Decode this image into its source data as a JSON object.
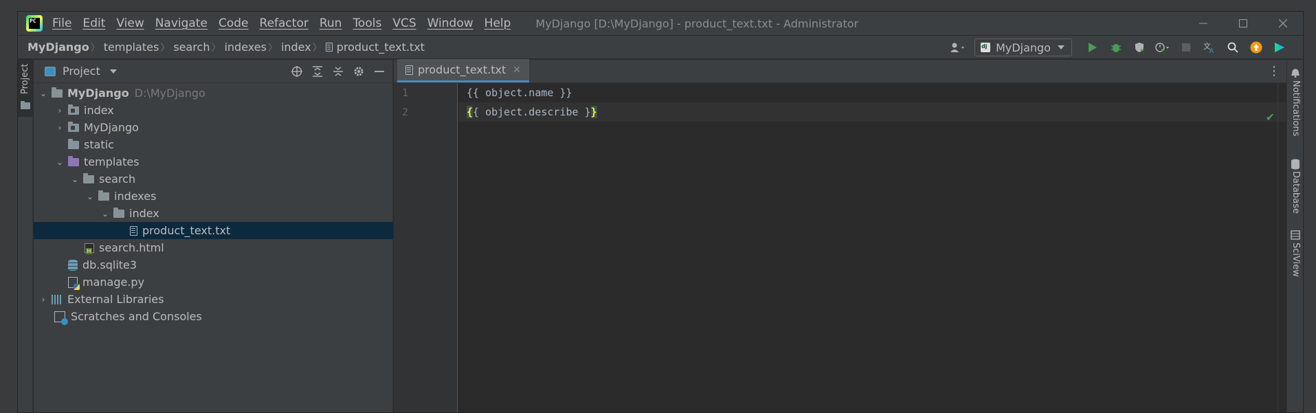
{
  "titlebar": {
    "menu": [
      "File",
      "Edit",
      "View",
      "Navigate",
      "Code",
      "Refactor",
      "Run",
      "Tools",
      "VCS",
      "Window",
      "Help"
    ],
    "window_title": "MyDjango [D:\\MyDjango] - product_text.txt - Administrator"
  },
  "breadcrumbs": [
    "MyDjango",
    "templates",
    "search",
    "indexes",
    "index",
    "product_text.txt"
  ],
  "run_config": {
    "label": "MyDjango"
  },
  "left_strip": {
    "tab_label": "Project"
  },
  "project_panel": {
    "title": "Project",
    "tree": [
      {
        "label": "MyDjango",
        "hint": "D:\\MyDjango"
      },
      {
        "label": "index"
      },
      {
        "label": "MyDjango"
      },
      {
        "label": "static"
      },
      {
        "label": "templates"
      },
      {
        "label": "search"
      },
      {
        "label": "indexes"
      },
      {
        "label": "index"
      },
      {
        "label": "product_text.txt"
      },
      {
        "label": "search.html"
      },
      {
        "label": "db.sqlite3"
      },
      {
        "label": "manage.py"
      },
      {
        "label": "External Libraries"
      },
      {
        "label": "Scratches and Consoles"
      }
    ]
  },
  "editor": {
    "tab_label": "product_text.txt",
    "line_numbers": [
      "1",
      "2"
    ],
    "lines": [
      {
        "text": "{{ object.name }}"
      },
      {
        "open": "{",
        "middle": "{ object.describe }",
        "close": "}"
      }
    ]
  },
  "right_strip": [
    "Notifications",
    "Database",
    "SciView"
  ],
  "colors": {
    "accent": "#4a88c7",
    "selection": "#0d293e",
    "background": "#2b2b2b",
    "panel": "#3c3f41"
  }
}
